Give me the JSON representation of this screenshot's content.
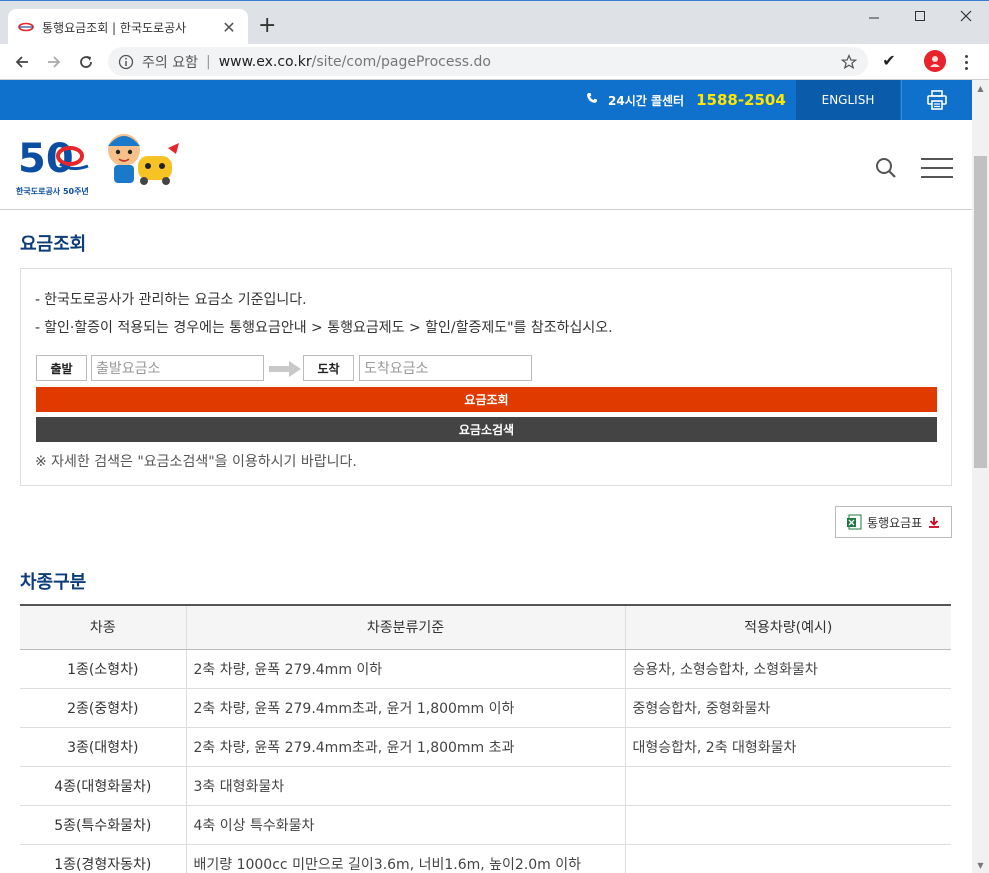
{
  "browser": {
    "tab_title": "통행요금조회 | 한국도로공사",
    "security_label": "주의 요함",
    "url_host": "www.ex.co.kr",
    "url_path": "/site/com/pageProcess.do",
    "favicon": "ex-logo-icon"
  },
  "topbar": {
    "callcenter_label": "24시간 콜센터",
    "callcenter_number": "1588-2504",
    "english": "ENGLISH"
  },
  "header": {
    "logo_caption": "한국도로공사 50주년",
    "logo_number": "50"
  },
  "fee_search": {
    "title": "요금조회",
    "notes": [
      "한국도로공사가 관리하는 요금소 기준입니다.",
      "할인·할증이 적용되는 경우에는 통행요금안내 > 통행요금제도 > 할인/할증제도\"를 참조하십시오."
    ],
    "depart_label": "출발",
    "depart_placeholder": "출발요금소",
    "arrive_label": "도착",
    "arrive_placeholder": "도착요금소",
    "search_button": "요금조회",
    "plaza_search_button": "요금소검색",
    "hint": "※ 자세한 검색은 \"요금소검색\"을 이용하시기 바랍니다.",
    "toll_table_button": "통행요금표"
  },
  "vehicle_class": {
    "title": "차종구분",
    "headers": [
      "차종",
      "차종분류기준",
      "적용차량(예시)"
    ],
    "rows": [
      [
        "1종(소형차)",
        "2축 차량, 윤폭 279.4mm 이하",
        "승용차, 소형승합차, 소형화물차"
      ],
      [
        "2종(중형차)",
        "2축 차량, 윤폭 279.4mm초과, 윤거 1,800mm 이하",
        "중형승합차, 중형화물차"
      ],
      [
        "3종(대형차)",
        "2축 차량, 윤폭 279.4mm초과, 윤거 1,800mm 초과",
        "대형승합차, 2축 대형화물차"
      ],
      [
        "4종(대형화물차)",
        "3축 대형화물차",
        ""
      ],
      [
        "5종(특수화물차)",
        "4축 이상 특수화물차",
        ""
      ],
      [
        "1종(경형자동차)",
        "배기량 1000cc 미만으로 길이3.6m, 너비1.6m, 높이2.0m 이하",
        ""
      ]
    ]
  },
  "colors": {
    "topbar_blue": "#0f71cc",
    "english_blue": "#0a5cab",
    "search_orange": "#e03a00",
    "plaza_gray": "#444444",
    "callcenter_yellow": "#ffe600",
    "title_navy": "#0c3c7a"
  }
}
